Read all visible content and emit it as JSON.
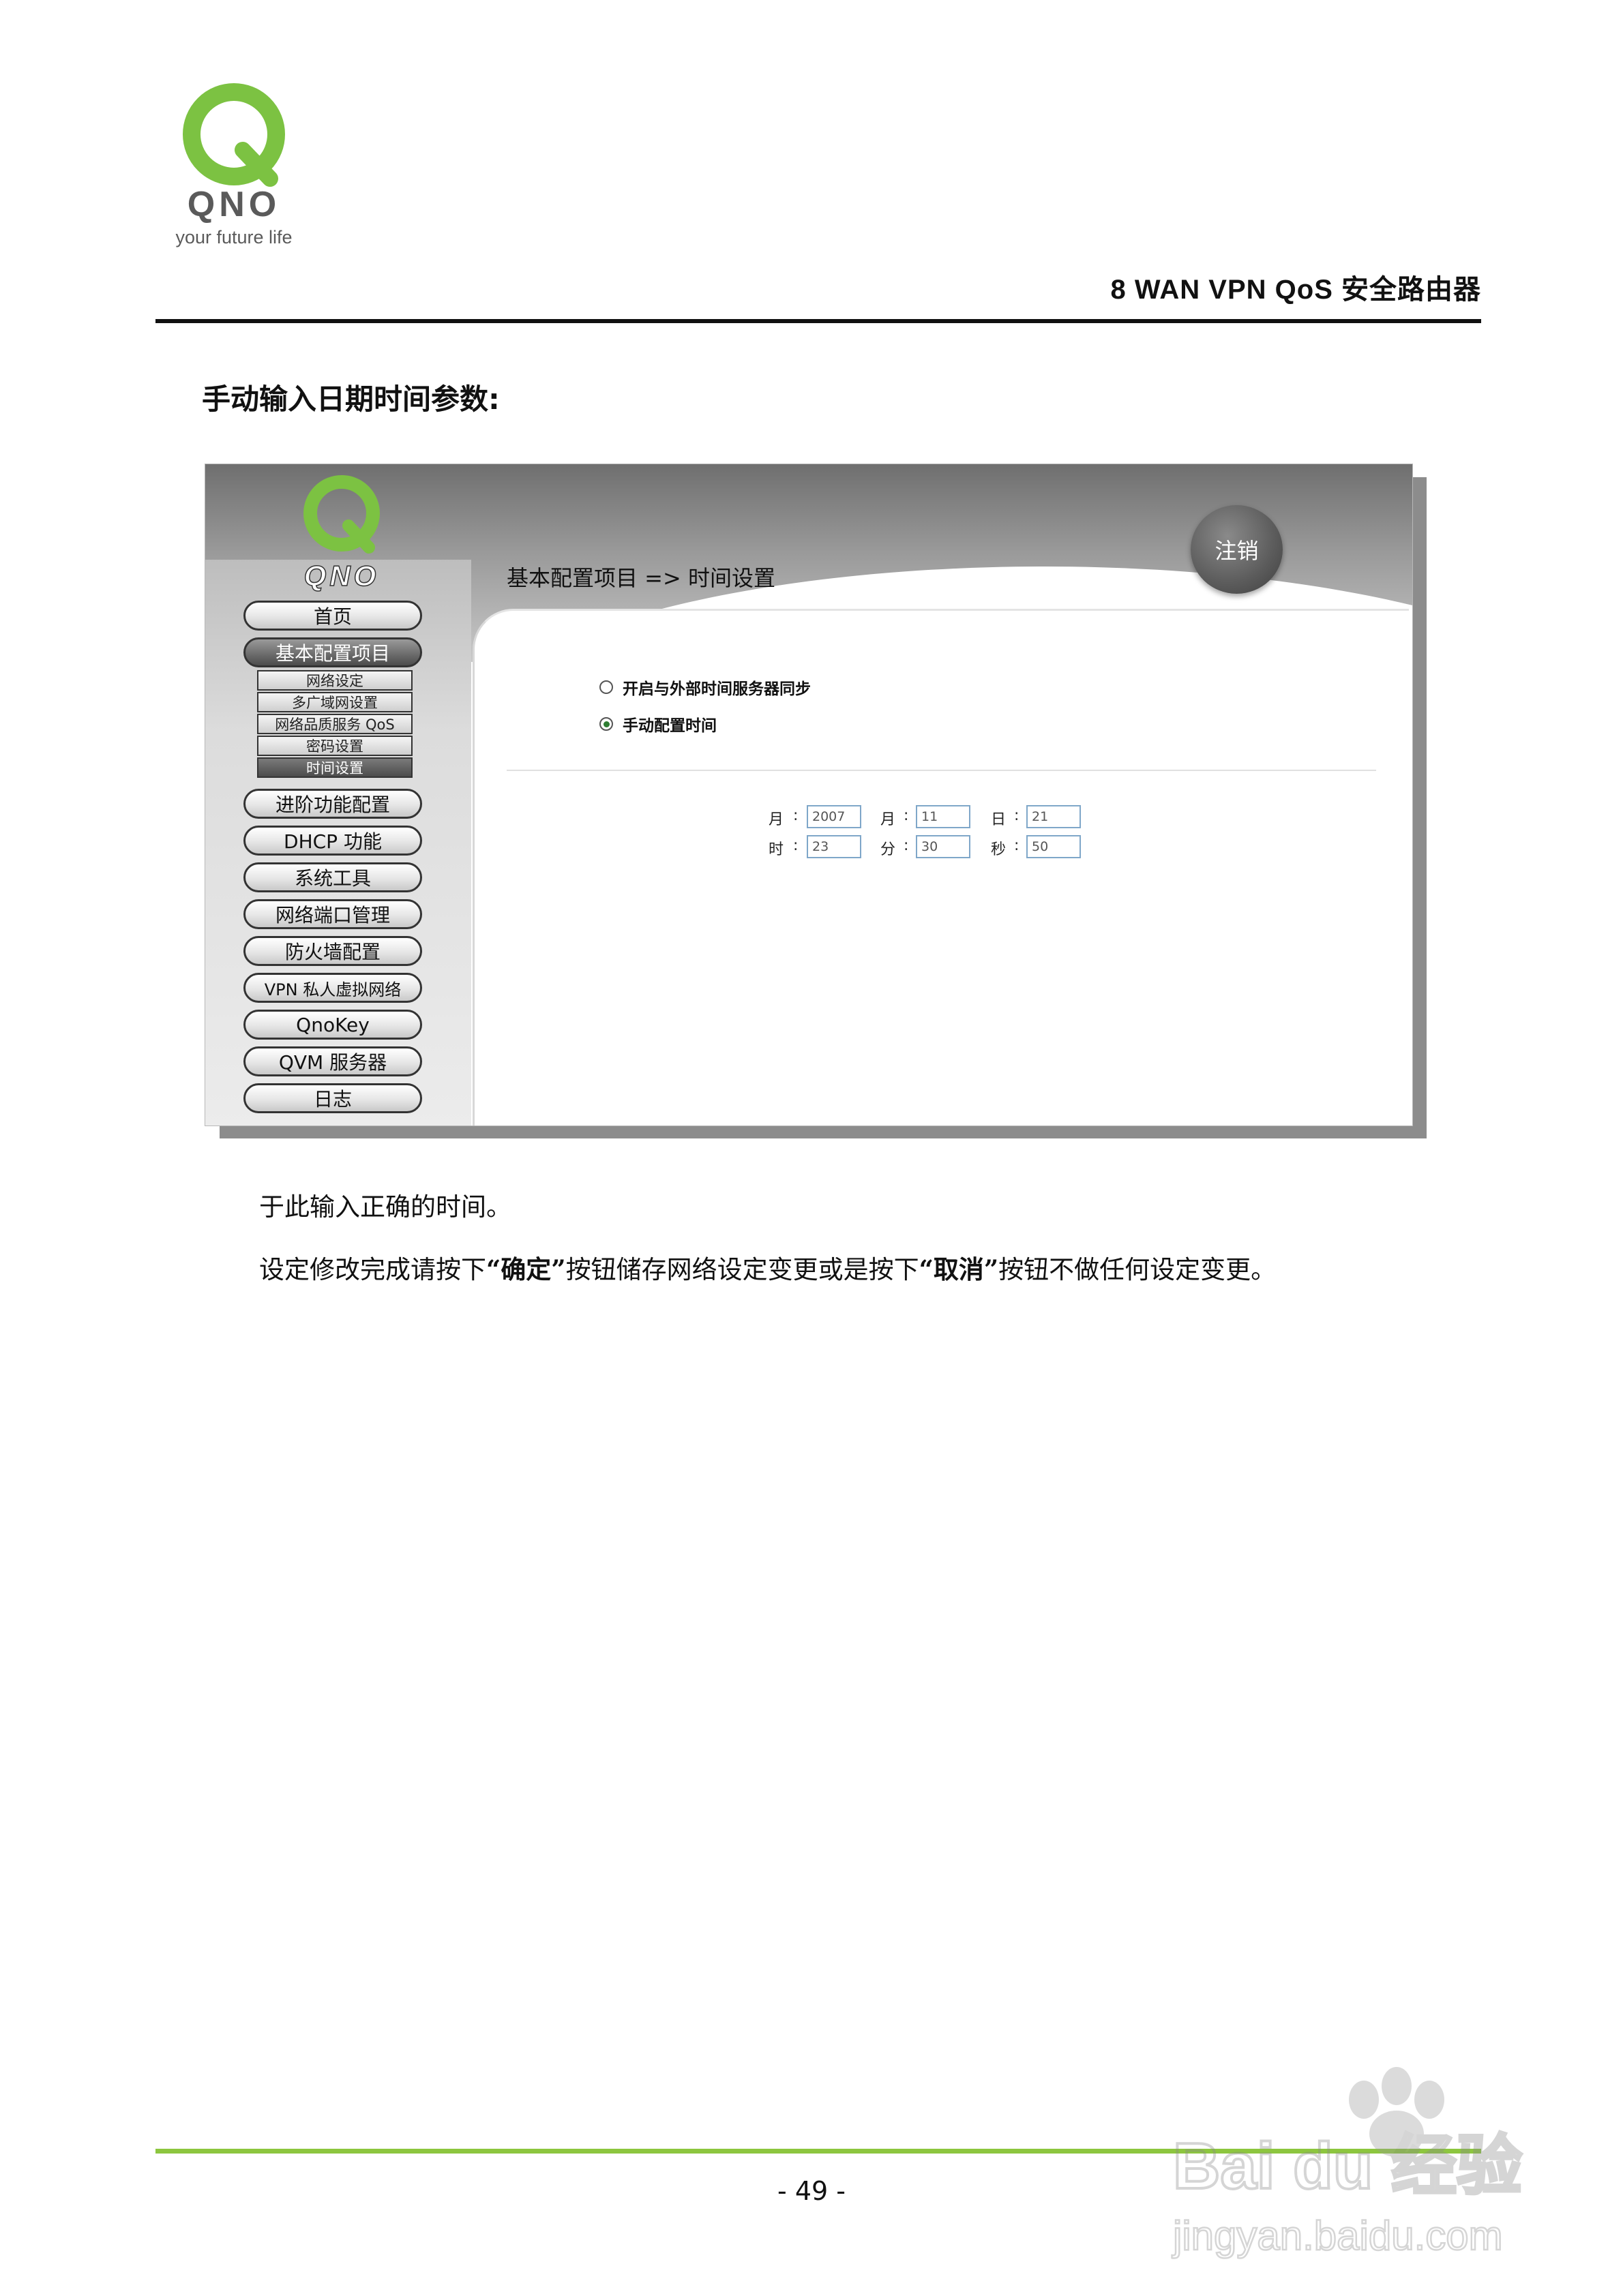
{
  "header": {
    "logo_brand": "QNO",
    "logo_tagline": "your future life",
    "title": "8  WAN  VPN  QoS  安全路由器"
  },
  "section_heading": "手动输入日期时间参数:",
  "screenshot": {
    "logo_text": "QNO",
    "logout_label": "注销",
    "breadcrumb": "基本配置项目  => 时间设置",
    "nav": [
      {
        "label": "首页",
        "active": false
      },
      {
        "label": "基本配置项目",
        "active": true
      },
      {
        "label": "进阶功能配置",
        "active": false
      },
      {
        "label": "DHCP 功能",
        "active": false
      },
      {
        "label": "系统工具",
        "active": false
      },
      {
        "label": "网络端口管理",
        "active": false
      },
      {
        "label": "防火墙配置",
        "active": false
      },
      {
        "label": "VPN 私人虚拟网络",
        "active": false
      },
      {
        "label": "QnoKey",
        "active": false
      },
      {
        "label": "QVM 服务器",
        "active": false
      },
      {
        "label": "日志",
        "active": false
      }
    ],
    "subnav": [
      {
        "label": "网络设定",
        "active": false
      },
      {
        "label": "多广域网设置",
        "active": false
      },
      {
        "label": "网络品质服务 QoS",
        "active": false
      },
      {
        "label": "密码设置",
        "active": false
      },
      {
        "label": "时间设置",
        "active": true
      }
    ],
    "options": [
      {
        "label": "开启与外部时间服务器同步",
        "selected": false
      },
      {
        "label": "手动配置时间",
        "selected": true
      }
    ],
    "time_fields": {
      "year_label": "月",
      "year_value": "2007",
      "month_label": "月",
      "month_value": "11",
      "day_label": "日",
      "day_value": "21",
      "hour_label": "时",
      "hour_value": "23",
      "minute_label": "分",
      "minute_value": "30",
      "second_label": "秒",
      "second_value": "50",
      "separator": ":"
    }
  },
  "body": {
    "para1": "于此输入正确的时间。",
    "para2_a": "设定修改完成请按下",
    "para2_ok": "“确定”",
    "para2_b": "按钮储存网络设定变更或是按下",
    "para2_cancel": "“取消”",
    "para2_c": "按钮不做任何设定变更。"
  },
  "footer": {
    "page_number": "- 49 -"
  },
  "watermark": {
    "brand": "Bai du 经验",
    "url": "jingyan.baidu.com"
  },
  "colors": {
    "accent_green": "#8dc63f",
    "logo_green": "#7cc242",
    "logo_gray": "#5a5a5a"
  }
}
